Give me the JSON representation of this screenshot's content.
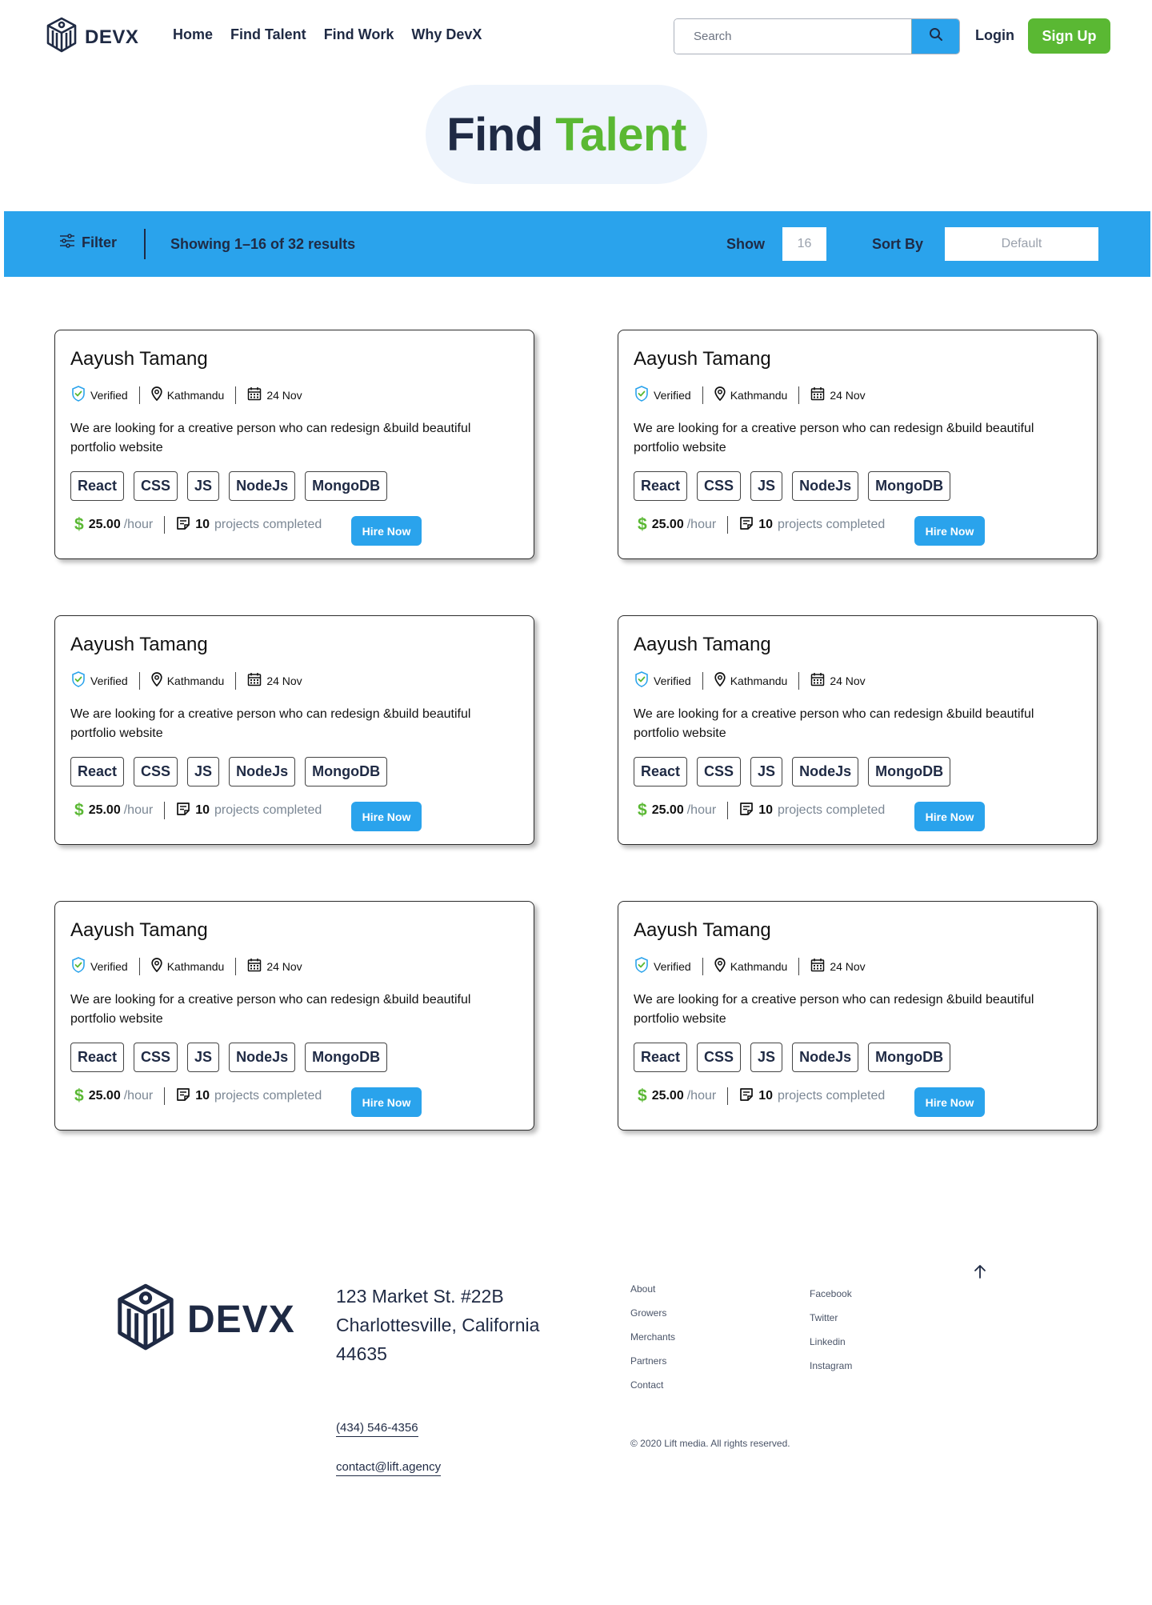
{
  "brand": {
    "name": "DEVX"
  },
  "nav": {
    "links": [
      "Home",
      "Find Talent",
      "Find Work",
      "Why DevX"
    ],
    "search_placeholder": "Search",
    "login": "Login",
    "signup": "Sign Up"
  },
  "hero": {
    "title_main": "Find",
    "title_accent": "Talent"
  },
  "filterbar": {
    "filter_label": "Filter",
    "results_text": "Showing 1–16 of 32 results",
    "show_label": "Show",
    "show_value": "16",
    "sort_label": "Sort By",
    "sort_value": "Default"
  },
  "cards": [
    {
      "name": "Aayush Tamang",
      "verified": "Verified",
      "location": "Kathmandu",
      "date": "24 Nov",
      "description": "We are looking for a creative person who can redesign &build beautiful portfolio website",
      "tags": [
        "React",
        "CSS",
        "JS",
        "NodeJs",
        "MongoDB"
      ],
      "rate": "25.00",
      "rate_unit": "/hour",
      "projects": "10",
      "projects_text": "projects completed",
      "hire_label": "Hire Now"
    },
    {
      "name": "Aayush Tamang",
      "verified": "Verified",
      "location": "Kathmandu",
      "date": "24 Nov",
      "description": "We are looking for a creative person who can redesign &build beautiful portfolio website",
      "tags": [
        "React",
        "CSS",
        "JS",
        "NodeJs",
        "MongoDB"
      ],
      "rate": "25.00",
      "rate_unit": "/hour",
      "projects": "10",
      "projects_text": "projects completed",
      "hire_label": "Hire Now"
    },
    {
      "name": "Aayush Tamang",
      "verified": "Verified",
      "location": "Kathmandu",
      "date": "24 Nov",
      "description": "We are looking for a creative person who can redesign &build beautiful portfolio website",
      "tags": [
        "React",
        "CSS",
        "JS",
        "NodeJs",
        "MongoDB"
      ],
      "rate": "25.00",
      "rate_unit": "/hour",
      "projects": "10",
      "projects_text": "projects completed",
      "hire_label": "Hire Now"
    },
    {
      "name": "Aayush Tamang",
      "verified": "Verified",
      "location": "Kathmandu",
      "date": "24 Nov",
      "description": "We are looking for a creative person who can redesign &build beautiful portfolio website",
      "tags": [
        "React",
        "CSS",
        "JS",
        "NodeJs",
        "MongoDB"
      ],
      "rate": "25.00",
      "rate_unit": "/hour",
      "projects": "10",
      "projects_text": "projects completed",
      "hire_label": "Hire Now"
    },
    {
      "name": "Aayush Tamang",
      "verified": "Verified",
      "location": "Kathmandu",
      "date": "24 Nov",
      "description": "We are looking for a creative person who can redesign &build beautiful portfolio website",
      "tags": [
        "React",
        "CSS",
        "JS",
        "NodeJs",
        "MongoDB"
      ],
      "rate": "25.00",
      "rate_unit": "/hour",
      "projects": "10",
      "projects_text": "projects completed",
      "hire_label": "Hire Now"
    },
    {
      "name": "Aayush Tamang",
      "verified": "Verified",
      "location": "Kathmandu",
      "date": "24 Nov",
      "description": "We are looking for a creative person who can redesign &build beautiful portfolio website",
      "tags": [
        "React",
        "CSS",
        "JS",
        "NodeJs",
        "MongoDB"
      ],
      "rate": "25.00",
      "rate_unit": "/hour",
      "projects": "10",
      "projects_text": "projects completed",
      "hire_label": "Hire Now"
    }
  ],
  "footer": {
    "brand": "DEVX",
    "address": [
      "123 Market St. #22B",
      "Charlottesville, California",
      "44635"
    ],
    "phone": "(434) 546-4356",
    "email": "contact@lift.agency",
    "links_col1": [
      "About",
      "Growers",
      "Merchants",
      "Partners",
      "Contact"
    ],
    "links_col2": [
      "Facebook",
      "Twitter",
      "Linkedin",
      "Instagram"
    ],
    "copyright": "© 2020 Lift media. All rights reserved."
  },
  "colors": {
    "primary_blue": "#2aa3ec",
    "accent_green": "#5ab833",
    "navy_text": "#1f2a44",
    "hero_bg": "#eef4fc"
  },
  "icons": [
    "devx-logo-icon",
    "search-icon",
    "filter-icon",
    "verified-shield-icon",
    "location-pin-icon",
    "calendar-icon",
    "dollar-icon",
    "projects-doc-icon",
    "arrow-up-icon"
  ]
}
